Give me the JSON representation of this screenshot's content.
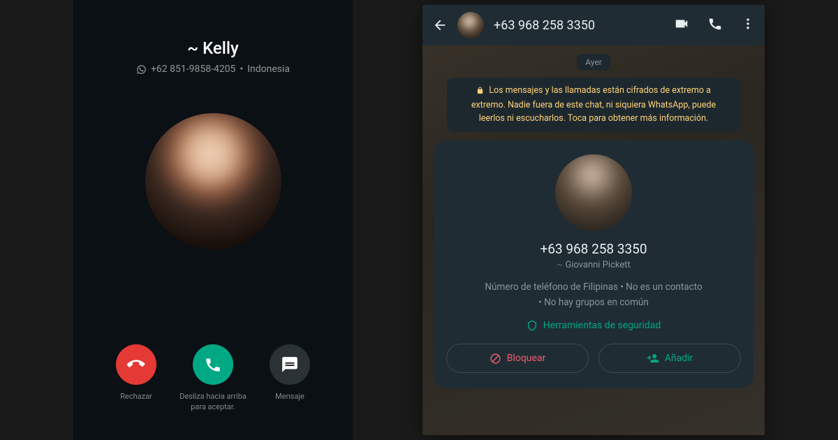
{
  "left_call": {
    "name": "~ Kelly",
    "phone": "+62 851-9858-4205",
    "country": "Indonesia",
    "decline_label": "Rechazar",
    "accept_label": "Desliza hacia arriba para aceptar.",
    "message_label": "Mensaje"
  },
  "right_chat": {
    "header": {
      "phone": "+63 968 258 3350"
    },
    "date_label": "Ayer",
    "encryption_text": "Los mensajes y las llamadas están cifrados de extremo a extremo. Nadie fuera de este chat, ni siquiera WhatsApp, puede leerlos ni escucharlos. Toca para obtener más información.",
    "card": {
      "phone": "+63 968 258 3350",
      "name": "Giovanni Pickett",
      "meta_line1": "Número de teléfono de Filipinas • No es un contacto",
      "meta_line2": "• No hay grupos en común",
      "security_label": "Herramientas de seguridad",
      "block_label": "Bloquear",
      "add_label": "Añadir"
    }
  }
}
